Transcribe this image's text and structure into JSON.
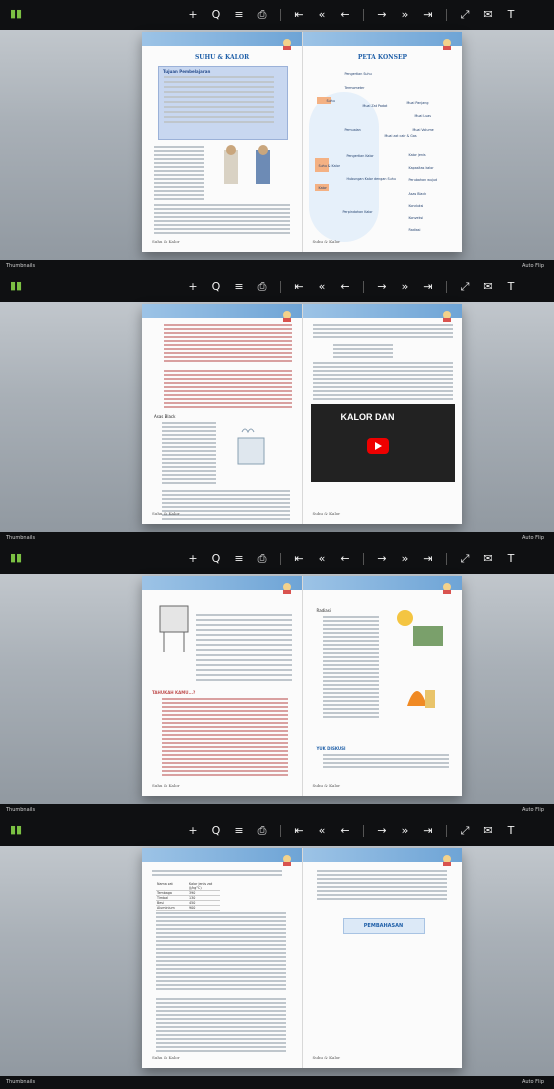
{
  "toolbar": {
    "tools": [
      {
        "name": "add-icon",
        "glyph": "+"
      },
      {
        "name": "zoom-icon",
        "glyph": "Q"
      },
      {
        "name": "menu-icon",
        "glyph": "≡"
      },
      {
        "name": "print-icon",
        "glyph": "⎙"
      },
      {
        "name": "first-page-icon",
        "glyph": "⇤"
      },
      {
        "name": "prev-icon",
        "glyph": "«"
      },
      {
        "name": "back-icon",
        "glyph": "←"
      },
      {
        "name": "forward-icon",
        "glyph": "→"
      },
      {
        "name": "next-icon",
        "glyph": "»"
      },
      {
        "name": "last-page-icon",
        "glyph": "⇥"
      },
      {
        "name": "fullscreen-icon",
        "glyph": "⤢"
      },
      {
        "name": "mail-icon",
        "glyph": "✉"
      },
      {
        "name": "text-icon",
        "glyph": "T"
      }
    ]
  },
  "bottom": {
    "thumbnails": "Thumbnails",
    "autoflip": "Auto Flip"
  },
  "spreads": [
    {
      "left": {
        "title": "SUHU & KALOR",
        "box_title": "Tujuan Pembelajaran",
        "footer": "Suhu & Kalor"
      },
      "right": {
        "title": "PETA KONSEP",
        "footer": "Suhu & Kalor",
        "nodes": [
          "Pengertian Suhu",
          "Termometer",
          "Suhu",
          "Muai Zat Padat",
          "Muai Panjang",
          "Muai Luas",
          "Muai Volume",
          "Pemuaian",
          "Muai zat cair & Gas",
          "Suhu & Kalor",
          "Pengertian Kalor",
          "Kalor jenis",
          "Kalor",
          "Kapasitas kalor",
          "Hubungan Kalor dengan Suhu",
          "Perubahan wujud",
          "Asas Black",
          "Konduksi",
          "Perpindahan Kalor",
          "Konveksi",
          "Radiasi"
        ]
      }
    },
    {
      "left": {
        "title": "",
        "heading": "Asas Black",
        "footer": "Suhu & Kalor"
      },
      "right": {
        "video_title": "KALOR DAN",
        "footer": "Suhu & Kalor"
      }
    },
    {
      "left": {
        "section": "TAHUKAH KAMU...?",
        "footer": "Suhu & Kalor"
      },
      "right": {
        "heading": "Radiasi",
        "section": "YUK DISKUSI",
        "footer": "Suhu & Kalor"
      }
    },
    {
      "left": {
        "footer": "Suhu & Kalor",
        "table_header": [
          "Nama zat",
          "Kalor jenis zat (J/kg°C)"
        ],
        "table_rows": [
          [
            "Tembaga",
            "390"
          ],
          [
            "Timbal",
            "130"
          ],
          [
            "Besi",
            "450"
          ],
          [
            "Aluminium",
            "900"
          ]
        ]
      },
      "right": {
        "button": "PEMBAHASAN",
        "footer": "Suhu & Kalor"
      }
    }
  ]
}
